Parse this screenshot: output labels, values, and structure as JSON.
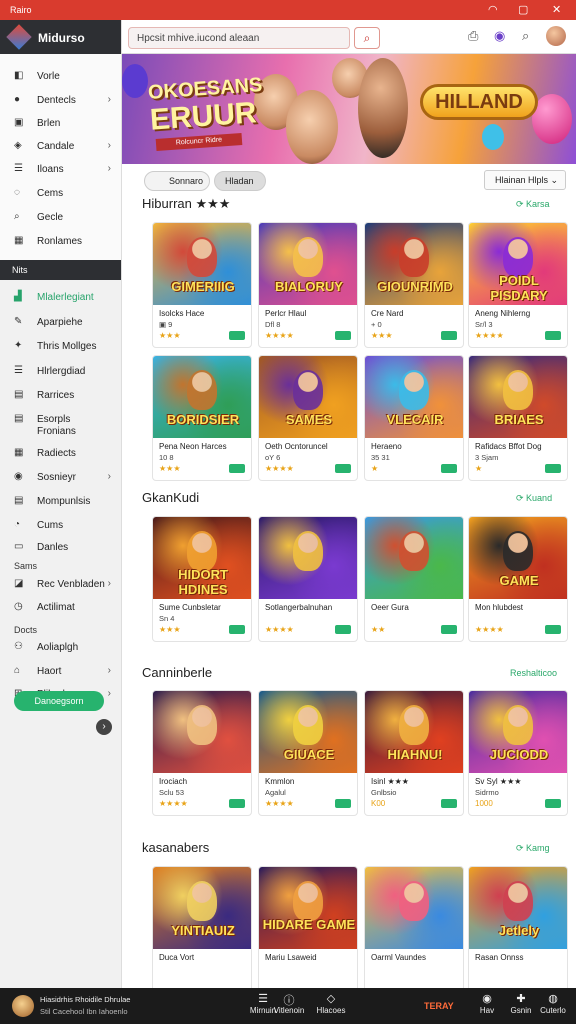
{
  "window": {
    "title": "Rairo"
  },
  "sidebar": {
    "brand": "Midurso",
    "items": [
      {
        "label": "Vorle",
        "icon": "grid-icon",
        "glyph": "◧",
        "chevron": false
      },
      {
        "label": "Dentecls",
        "icon": "dot-icon",
        "glyph": "●",
        "chevron": true
      },
      {
        "label": "Brlen",
        "icon": "square-icon",
        "glyph": "▣",
        "chevron": false
      },
      {
        "label": "Candale",
        "icon": "location-icon",
        "glyph": "◈",
        "chevron": true
      },
      {
        "label": "Iloans",
        "icon": "list-icon",
        "glyph": "☰",
        "chevron": true
      },
      {
        "label": "Cems",
        "icon": "gem-icon",
        "glyph": "◌",
        "chevron": false
      },
      {
        "label": "Gecle",
        "icon": "search-icon",
        "glyph": "⌕",
        "chevron": false
      },
      {
        "label": "Ronlames",
        "icon": "image-icon",
        "glyph": "▦",
        "chevron": false
      }
    ],
    "section_nits": "Nits",
    "items2": [
      {
        "label": "Mlalerlegiant",
        "icon": "chart-icon",
        "glyph": "▟",
        "active": true,
        "chevron": false
      },
      {
        "label": "Aparpiehe",
        "icon": "edit-icon",
        "glyph": "✎",
        "chevron": false
      },
      {
        "label": "Thris Mollges",
        "icon": "puzzle-icon",
        "glyph": "✦",
        "chevron": false
      },
      {
        "label": "Hlrlergdiad",
        "icon": "list-icon",
        "glyph": "☰",
        "chevron": false
      },
      {
        "label": "Rarrices",
        "icon": "doc-icon",
        "glyph": "▤",
        "chevron": false
      },
      {
        "label": "Esorpls\nFronians",
        "icon": "doc-icon",
        "glyph": "▤",
        "chevron": false
      },
      {
        "label": "Radiects",
        "icon": "grid-icon",
        "glyph": "▦",
        "chevron": false
      },
      {
        "label": "Sosnieyr",
        "icon": "settings-icon",
        "glyph": "◉",
        "chevron": true
      },
      {
        "label": "Mompunlsis",
        "icon": "doc-icon",
        "glyph": "▤",
        "chevron": false
      },
      {
        "label": "Cums",
        "icon": "chat-icon",
        "glyph": "◔",
        "chevron": false
      },
      {
        "label": "Danles",
        "icon": "card-icon",
        "glyph": "▭",
        "chevron": false
      }
    ],
    "section_sams": "Sams",
    "items3": [
      {
        "label": "Rec Venbladen",
        "icon": "tag-icon",
        "glyph": "◪",
        "chevron": true
      },
      {
        "label": "Actilimat",
        "icon": "clock-icon",
        "glyph": "◷",
        "chevron": false
      }
    ],
    "section_docts": "Docts",
    "items4": [
      {
        "label": "Aoliaplgh",
        "icon": "people-icon",
        "glyph": "⚇",
        "chevron": false
      },
      {
        "label": "Haort",
        "icon": "home-icon",
        "glyph": "⌂",
        "chevron": true
      },
      {
        "label": "Plibark",
        "icon": "link-icon",
        "glyph": "⊞",
        "chevron": true
      }
    ],
    "cta": "Danoegsorn",
    "collapse": "›"
  },
  "search": {
    "text": "Hpcsit mhive.iucond aleaan"
  },
  "banner": {
    "line1": "OKOESANS",
    "line2": "ERUUR",
    "ribbon": "Rolcuncr Ridre",
    "pill": "HILLAND"
  },
  "filters": {
    "chip1": "Sonnaro",
    "chip2": "Hladan",
    "sort": "Hlainan Hlpls"
  },
  "sections": [
    {
      "title": "Hiburran ★★★",
      "link": "Karsa",
      "rows": [
        [
          {
            "art": "GIMERIIIG",
            "title": "Isolcks Hace",
            "sub": "▣ 9",
            "stars": "★★★"
          },
          {
            "art": "BIALORUY",
            "title": "Perlcr Hlaul",
            "sub": "Dfl 8",
            "stars": "★★★★"
          },
          {
            "art": "GIOUNRIMD",
            "title": "Cre Nard",
            "sub": "+ 0",
            "stars": "★★★"
          },
          {
            "art": "POIDL PISDARY",
            "title": "Aneng Nihlerng",
            "sub": "Sr/l 3",
            "stars": "★★★★"
          }
        ],
        [
          {
            "art": "BORIDSIER",
            "title": "Pena Neon Harces",
            "sub": "10 8",
            "stars": "★★★"
          },
          {
            "art": "SAMES",
            "title": "Oeth Ocntoruncel",
            "sub": "oY 6",
            "stars": "★★★★"
          },
          {
            "art": "VLECAIR",
            "title": "Heraeno",
            "sub": "35 31",
            "stars": "★"
          },
          {
            "art": "BRIAES",
            "title": "Rafidacs Bffot Dog",
            "sub": "3 Sjam",
            "stars": "★"
          }
        ]
      ]
    },
    {
      "title": "GkanKudi",
      "link": "Kuand",
      "rows": [
        [
          {
            "art": "HIDORT HDINES",
            "title": "Sume Cunbsletar",
            "sub": "Sn 4",
            "stars": "★★★"
          },
          {
            "art": "",
            "title": "Sotlangerbalnuhan",
            "sub": "",
            "stars": "★★★★"
          },
          {
            "art": "",
            "title": "Oeer Gura",
            "sub": "",
            "stars": "★★"
          },
          {
            "art": "GAME",
            "title": "Mon hlubdest",
            "sub": "",
            "stars": "★★★★"
          }
        ]
      ]
    },
    {
      "title": "Canninberle",
      "link": "Reshalticoo",
      "rows": [
        [
          {
            "art": "",
            "title": "Irociach",
            "sub": "Sclu 53",
            "stars": "★★★★"
          },
          {
            "art": "GIUACE",
            "title": "Kmmlon",
            "sub": "Agalul",
            "stars": "★★★★"
          },
          {
            "art": "HIAHNU!",
            "title": "Isinl ★★★",
            "sub": "Gnlbsio",
            "stars": "K00"
          },
          {
            "art": "JUCIODD",
            "title": "Sv Syl ★★★",
            "sub": "Sidrmo",
            "stars": "1000"
          }
        ]
      ]
    },
    {
      "title": "kasanabers",
      "link": "Kamg",
      "rows": [
        [
          {
            "art": "YINTIAUIZ",
            "title": "Duca Vort",
            "sub": "",
            "stars": ""
          },
          {
            "art": "HIDARE GAME",
            "title": "Mariu Lsaweid",
            "sub": "",
            "stars": ""
          },
          {
            "art": "",
            "title": "Oarml Vaundes",
            "sub": "",
            "stars": ""
          },
          {
            "art": "Jetlely",
            "title": "Rasan Onnss",
            "sub": "",
            "stars": ""
          }
        ]
      ]
    }
  ],
  "bottombar": {
    "line1": "Hiasidrhis Rhoidile Dhrulae",
    "line2": "Stil Cacehool Ibn Iahoenlo",
    "nav": [
      {
        "label": "Mirnuin",
        "icon": "menu-icon",
        "glyph": "☰"
      },
      {
        "label": "Vitlenoin",
        "icon": "info-icon",
        "glyph": "ⓘ"
      },
      {
        "label": "Hlacoes",
        "icon": "shield-icon",
        "glyph": "◇"
      }
    ],
    "brand": "TERAY",
    "right": [
      {
        "label": "Hav",
        "icon": "gamepad-icon",
        "glyph": "◉"
      },
      {
        "label": "Gsnin",
        "icon": "joystick-icon",
        "glyph": "✚"
      },
      {
        "label": "Cuterlo",
        "icon": "user-icon",
        "glyph": "◍"
      }
    ]
  },
  "colors": {
    "accent": "#d93b2e",
    "green": "#27b36e",
    "sidebar_dark": "#2d2f33"
  }
}
